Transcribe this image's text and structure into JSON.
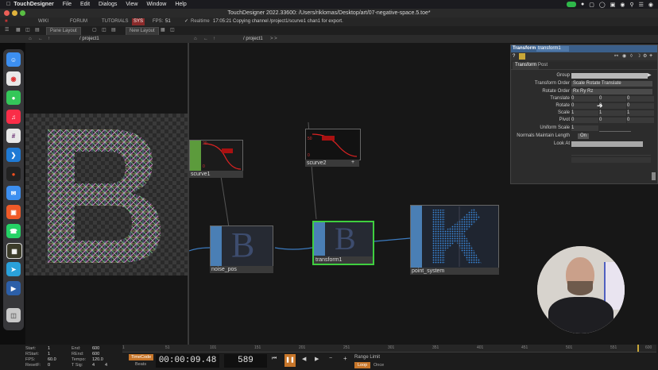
{
  "menubar": {
    "app": "TouchDesigner",
    "items": [
      "File",
      "Edit",
      "Dialogs",
      "View",
      "Window",
      "Help"
    ]
  },
  "window": {
    "title": "TouchDesigner 2022.33600: /Users/riklomas/Desktop/art/07-negative-space.5.toe*"
  },
  "toolbar": {
    "wiki": "WIKI",
    "forum": "FORUM",
    "tutorials": "TUTORIALS",
    "fps_badge": "SYS",
    "fps_label": "FPS:",
    "fps_value": "51",
    "realtime": "Realtime",
    "status": "17:05:21 Copying channel /project1/scurve1 chan1 for export."
  },
  "panebar": {
    "pane_layout": "Pane Layout",
    "new_layout": "New Layout"
  },
  "pathbar": {
    "left_path": "/ project1",
    "net_path": "/ project1",
    "nav": "> >"
  },
  "nodes": {
    "scurve1": "scurve1",
    "scurve2": "scurve2",
    "noise_pos": "noise_pos",
    "transform1": "transform1",
    "point_system": "point_system",
    "scurve1_top": "20",
    "scurve1_bottom": "0",
    "scurve2_top": "50",
    "scurve2_bottom": "0"
  },
  "params": {
    "op_type": "Transform",
    "op_name": "transform1",
    "tabs": [
      "Transform",
      "Post"
    ],
    "rows": [
      {
        "label": "Group",
        "values": []
      },
      {
        "label": "Transform Order",
        "values": [
          "Scale Rotate Translate"
        ]
      },
      {
        "label": "Rotate Order",
        "values": [
          "Rx Ry Rz"
        ]
      },
      {
        "label": "Translate",
        "values": [
          "0",
          "0",
          "0"
        ]
      },
      {
        "label": "Rotate",
        "values": [
          "0",
          "0",
          "0"
        ]
      },
      {
        "label": "Scale",
        "values": [
          "1",
          "1",
          "1"
        ]
      },
      {
        "label": "Pivot",
        "values": [
          "0",
          "0",
          "0"
        ]
      },
      {
        "label": "Uniform Scale",
        "values": [
          "1"
        ]
      },
      {
        "label": "Normals Maintain Length",
        "values": [
          "On"
        ]
      },
      {
        "label": "Look At",
        "values": []
      }
    ]
  },
  "timeline": {
    "start_label": "Start:",
    "start": "1",
    "end_label": "End:",
    "end": "600",
    "rstart_label": "RStart:",
    "rstart": "1",
    "rend_label": "REnd:",
    "rend": "600",
    "fps_label": "FPS:",
    "fps": "60.0",
    "tempo_label": "Tempo:",
    "tempo": "120.0",
    "resetf_label": "ResetF:",
    "resetf": "0",
    "tsig_label": "T Sig:",
    "tsig_a": "4",
    "tsig_b": "4",
    "timecode": "TimeCode",
    "beats": "Beats",
    "time_display": "00:00:09.48",
    "frame": "589",
    "range_limit": "Range Limit",
    "loop": "Loop",
    "once": "Once",
    "ruler": [
      "1",
      "51",
      "101",
      "151",
      "201",
      "251",
      "301",
      "351",
      "401",
      "451",
      "501",
      "551",
      "600"
    ]
  },
  "colors": {
    "accent_blue": "#4a86c8",
    "select_green": "#3fcf3f",
    "chop_green": "#5c9b3c",
    "sop_blue": "#4a7fb5"
  }
}
